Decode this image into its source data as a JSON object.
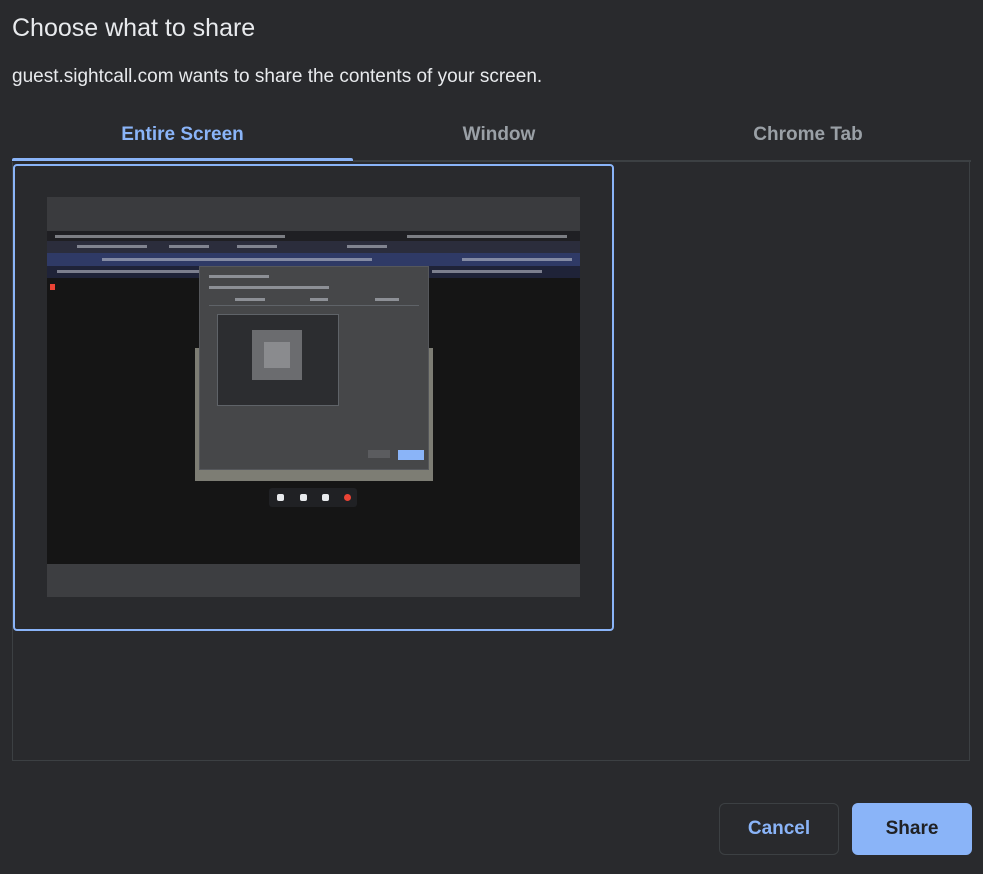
{
  "dialog": {
    "title": "Choose what to share",
    "subtitle": "guest.sightcall.com wants to share the contents of your screen."
  },
  "tabs": [
    {
      "label": "Entire Screen",
      "active": true
    },
    {
      "label": "Window",
      "active": false
    },
    {
      "label": "Chrome Tab",
      "active": false
    }
  ],
  "sources": [
    {
      "type": "screen",
      "selected": true,
      "thumbnail_icon": "screen-preview"
    }
  ],
  "buttons": {
    "cancel_label": "Cancel",
    "share_label": "Share"
  },
  "colors": {
    "background": "#292a2d",
    "accent": "#8ab4f8",
    "border": "#3c4043",
    "text": "#e8eaed",
    "muted_text": "#9aa0a6"
  }
}
